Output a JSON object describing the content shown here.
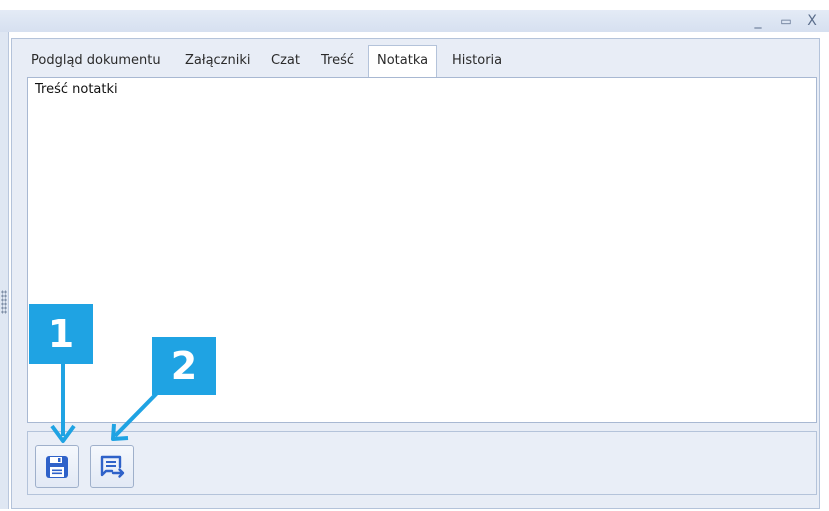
{
  "window": {
    "minimize_glyph": "_",
    "maximize_glyph": "▭",
    "close_glyph": "X"
  },
  "tabs": [
    {
      "label": "Podgląd dokumentu",
      "active": false
    },
    {
      "label": "Załączniki",
      "active": false
    },
    {
      "label": "Czat",
      "active": false
    },
    {
      "label": "Treść",
      "active": false
    },
    {
      "label": "Notatka",
      "active": true
    },
    {
      "label": "Historia",
      "active": false
    }
  ],
  "note": {
    "label": "Treść notatki"
  },
  "toolbar": {
    "buttons": [
      {
        "icon": "save-icon"
      },
      {
        "icon": "note-export-icon"
      }
    ]
  },
  "callouts": [
    {
      "number": "1"
    },
    {
      "number": "2"
    }
  ],
  "colors": {
    "accent": "#1fa3e3",
    "icon_blue": "#2f62c9"
  }
}
